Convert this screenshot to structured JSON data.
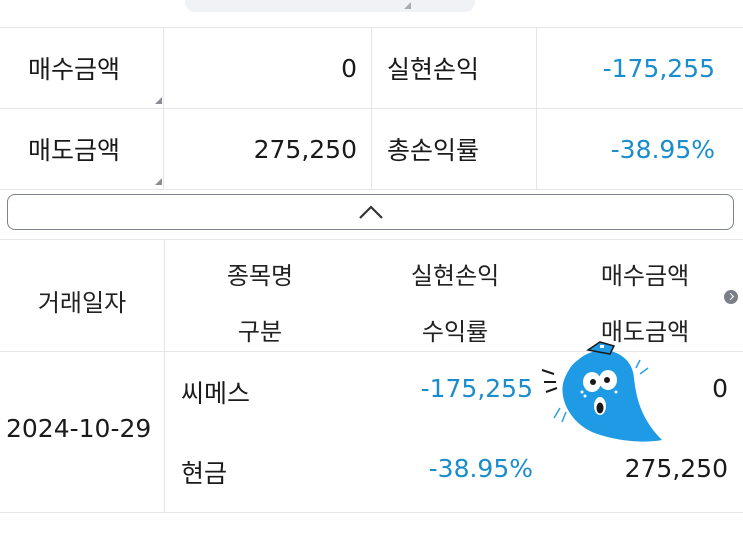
{
  "summary": {
    "rows": [
      {
        "label1": "매수금액",
        "value1": "0",
        "label2": "실현손익",
        "value2": "-175,255"
      },
      {
        "label1": "매도금액",
        "value1": "275,250",
        "label2": "총손익률",
        "value2": "-38.95%"
      }
    ]
  },
  "collapse_icon": "chevron-up-icon",
  "table": {
    "headers": {
      "date": "거래일자",
      "name": "종목명",
      "type": "구분",
      "realized": "실현손익",
      "rate": "수익률",
      "buy": "매수금액",
      "sell": "매도금액"
    },
    "rows": [
      {
        "date": "2024-10-29",
        "name": "씨메스",
        "type": "현금",
        "realized": "-175,255",
        "rate": "-38.95%",
        "buy": "0",
        "sell": "275,250"
      }
    ]
  },
  "colors": {
    "accent": "#1a8dcc",
    "border": "#e4e6ea"
  }
}
